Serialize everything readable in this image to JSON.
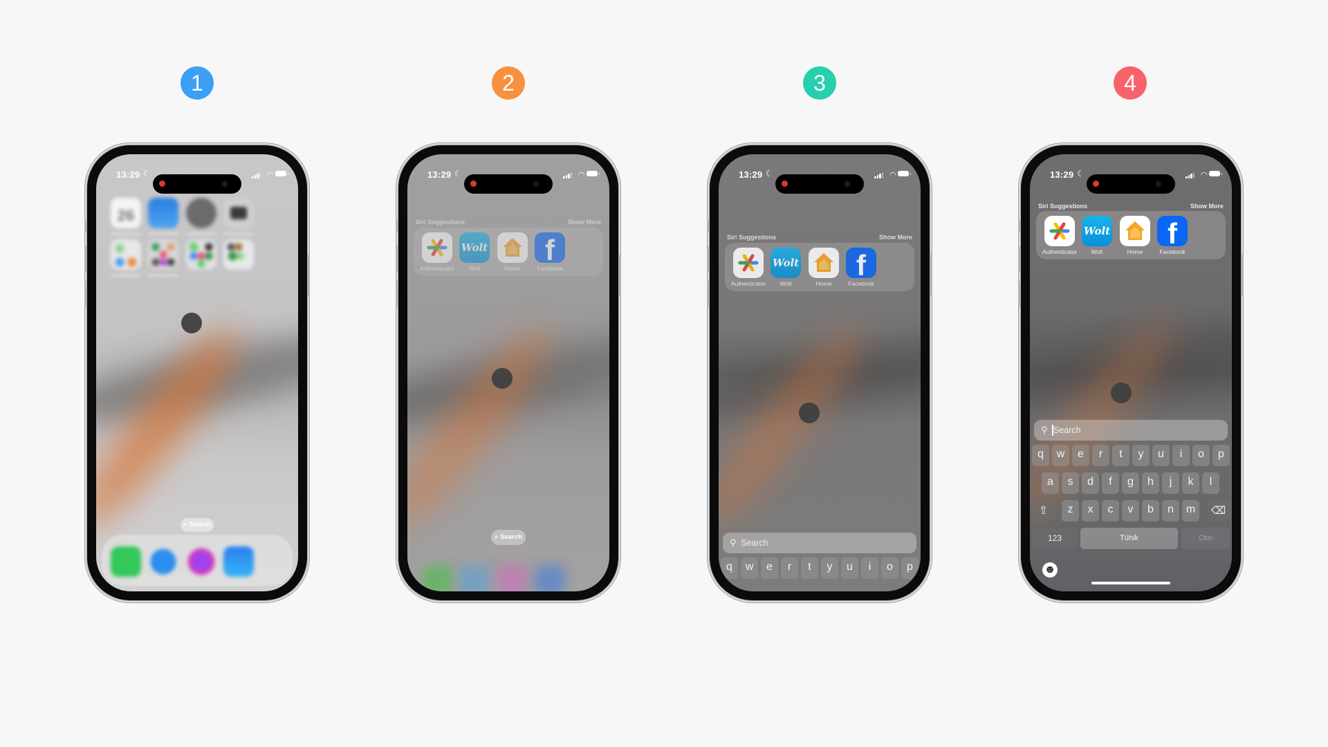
{
  "steps": [
    {
      "number": "1",
      "color": "#3b9ff5"
    },
    {
      "number": "2",
      "color": "#f8913f"
    },
    {
      "number": "3",
      "color": "#26cfad"
    },
    {
      "number": "4",
      "color": "#f8626a"
    }
  ],
  "status_bar": {
    "time": "13:29",
    "focus_icon": "moon-icon",
    "signal_icon": "cellular-signal-icon",
    "wifi_icon": "wifi-icon",
    "battery_icon": "battery-icon"
  },
  "home_screen": {
    "calendar_day": "26",
    "row1_icons": [
      "calendar-icon",
      "weather-icon",
      "settings-icon",
      "camera-icon"
    ],
    "row2_icons": [
      "folder-icon",
      "folder-icon",
      "folder-icon",
      "folder-icon"
    ],
    "search_pill": "Search",
    "dock_icons": [
      "phone-icon",
      "safari-icon",
      "messenger-icon",
      "mail-icon"
    ]
  },
  "siri": {
    "title": "Siri Suggestions",
    "show_more": "Show More",
    "apps": [
      {
        "name": "Authenticator",
        "icon": "authenticator-icon"
      },
      {
        "name": "Wolt",
        "icon": "wolt-icon",
        "logo_text": "Wolt"
      },
      {
        "name": "Home",
        "icon": "home-app-icon"
      },
      {
        "name": "Facebook",
        "icon": "facebook-icon",
        "logo_text": "f"
      }
    ]
  },
  "search": {
    "placeholder": "Search",
    "icon": "magnifier-icon"
  },
  "keyboard": {
    "row1": [
      "q",
      "w",
      "e",
      "r",
      "t",
      "y",
      "u",
      "i",
      "o",
      "p"
    ],
    "row2": [
      "a",
      "s",
      "d",
      "f",
      "g",
      "h",
      "j",
      "k",
      "l"
    ],
    "row3": [
      "z",
      "x",
      "c",
      "v",
      "b",
      "n",
      "m"
    ],
    "shift_icon": "shift-icon",
    "delete_icon": "delete-icon",
    "numbers_key": "123",
    "space_key": "Tühik",
    "go_key": "Otsi",
    "emoji_icon": "emoji-icon"
  }
}
